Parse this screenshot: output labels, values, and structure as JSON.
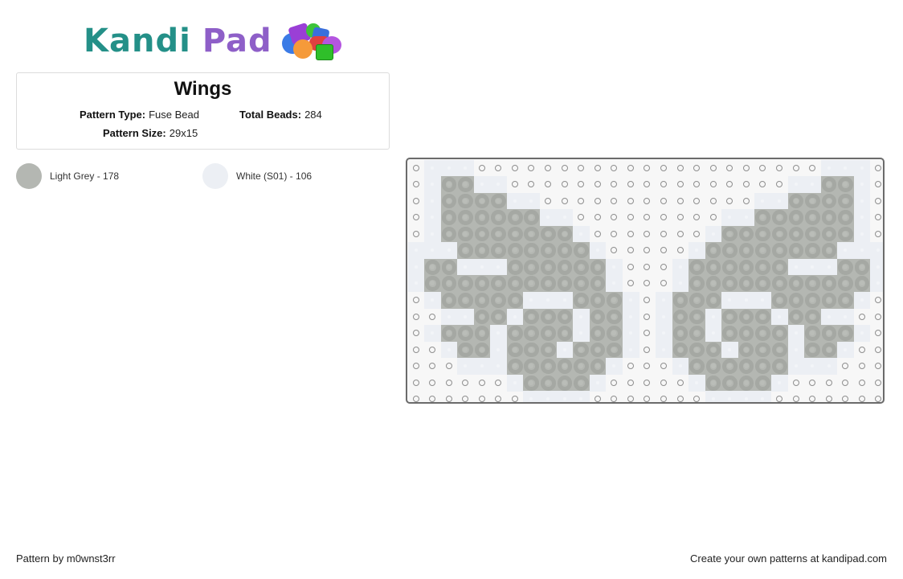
{
  "logo": {
    "part1": "Kandi",
    "part2": "Pad",
    "colors": {
      "kandi": "#249088",
      "pad": "#8e5fc8"
    }
  },
  "pattern": {
    "title": "Wings",
    "type_label": "Pattern Type:",
    "type_value": "Fuse Bead",
    "beads_label": "Total Beads:",
    "beads_value": "284",
    "size_label": "Pattern Size:",
    "size_value": "29x15"
  },
  "legend": [
    {
      "name": "Light Grey",
      "count": "178",
      "text": "Light Grey - 178",
      "color": "#b4b7b2",
      "code": "g"
    },
    {
      "name": "White (S01)",
      "count": "106",
      "text": "White (S01) - 106",
      "color": "#eceff4",
      "code": "w"
    }
  ],
  "grid": {
    "columns": 29,
    "rows_count": 15,
    "key": {
      "e": "empty peg",
      "g": "Light Grey",
      "w": "White (S01)"
    },
    "rows": [
      "ewwweeeeeeeeeeeeeeeeeeeeewwwe",
      "ewggwweeeeeeeeeeeeeeeeewwggwe",
      "ewggggwweeeeeeeeeeeeewwggggwe",
      "ewggggggwweeeeeeeeewwggggggwe",
      "ewggggggggweeeeeeewggggggggwe",
      "wwwggggggggweeeeewggggggggwww",
      "wggwwwggggggweeewggggggwwwggw",
      "wgggggggggggweeewgggggggggggw",
      "ewgggggwwwgggwewgggwwwgggggwe",
      "eewwggwgggwggwewggwgggwggwwee",
      "ewgggwggggwggwewggwggggwgggwe",
      "eewggwgggwgggwewgggwgggwggwee",
      "eeewwwggggggweeewggggggwwweee",
      "eeeeeewggggweeeeewggggweeeeee",
      "eeeeeeewwwweeeeeeewwwweeeeeee"
    ]
  },
  "footer": {
    "credit": "Pattern by m0wnst3rr",
    "cta": "Create your own patterns at kandipad.com"
  }
}
